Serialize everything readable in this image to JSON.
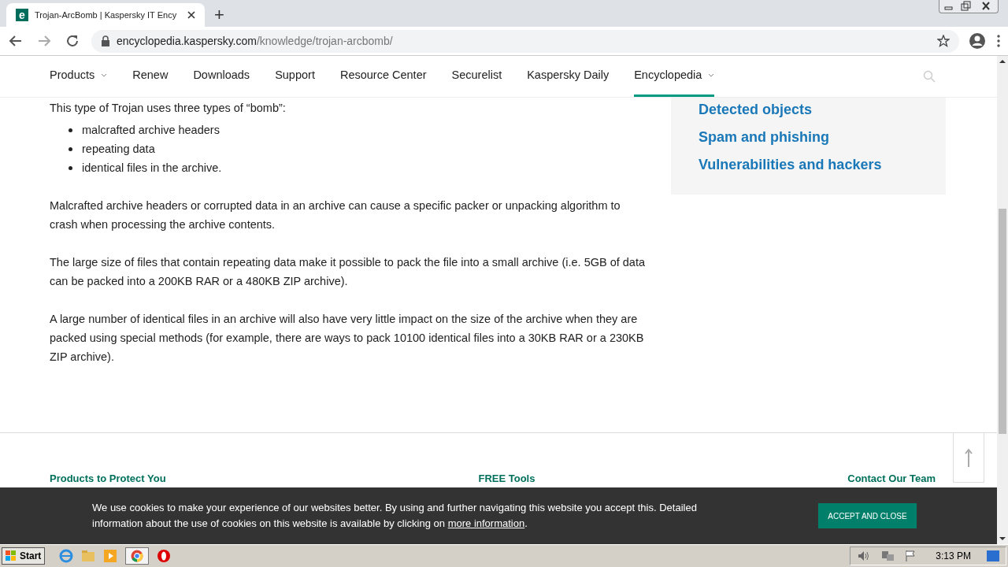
{
  "browser": {
    "tab": {
      "title": "Trojan-ArcBomb | Kaspersky IT Ency",
      "favicon": "e"
    },
    "new_tab": "+",
    "url": {
      "host": "encyclopedia.kaspersky.com",
      "path": "/knowledge/trojan-arcbomb/"
    }
  },
  "nav": {
    "items": [
      {
        "label": "Products",
        "dropdown": true,
        "selected": false
      },
      {
        "label": "Renew",
        "dropdown": false,
        "selected": false
      },
      {
        "label": "Downloads",
        "dropdown": false,
        "selected": false
      },
      {
        "label": "Support",
        "dropdown": false,
        "selected": false
      },
      {
        "label": "Resource Center",
        "dropdown": false,
        "selected": false
      },
      {
        "label": "Securelist",
        "dropdown": false,
        "selected": false
      },
      {
        "label": "Kaspersky Daily",
        "dropdown": false,
        "selected": false
      },
      {
        "label": "Encyclopedia",
        "dropdown": true,
        "selected": true
      }
    ]
  },
  "article": {
    "intro": "This type of Trojan uses three types of “bomb”:",
    "bullets": [
      "malcrafted archive headers",
      "repeating data",
      "identical files in the archive."
    ],
    "paragraphs": [
      "Malcrafted archive headers or corrupted data in an archive can cause a specific packer or unpacking algorithm to crash when processing the archive contents.",
      "The large size of files that contain repeating data make it possible to pack the file into a small archive (i.e. 5GB of data can be packed into a 200KB RAR or a 480KB ZIP archive).",
      "A large number of identical files in an archive will also have very little impact on the size of the archive when they are packed using special methods (for example, there are ways to pack 10100 identical files into a 30KB RAR or a 230KB ZIP archive)."
    ]
  },
  "sidebar": {
    "links": [
      "Detected objects",
      "Spam and phishing",
      "Vulnerabilities and hackers"
    ]
  },
  "footer": {
    "headings": [
      "Products to Protect You",
      "FREE Tools",
      "Contact Our Team"
    ]
  },
  "cookie_banner": {
    "text": "We use cookies to make your experience of our websites better. By using and further navigating this website you accept this. Detailed information about the use of cookies on this website is available by clicking on",
    "link": "more information",
    "end": ".",
    "button": "ACCEPT AND CLOSE"
  },
  "taskbar": {
    "start": "Start",
    "clock": "3:13 PM"
  }
}
